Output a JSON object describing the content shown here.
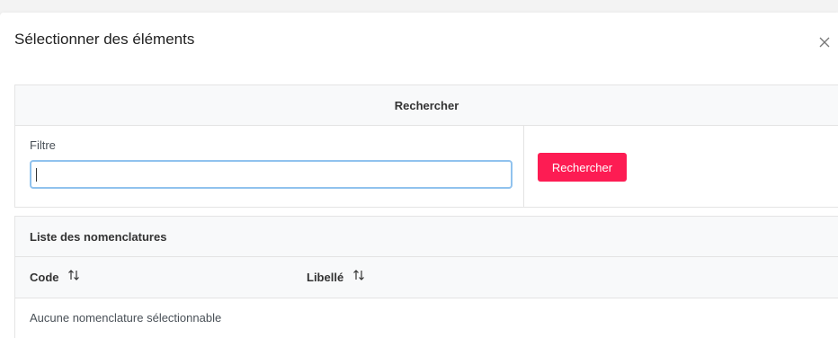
{
  "dialog": {
    "title": "Sélectionner des éléments",
    "close_icon": "close-icon"
  },
  "search": {
    "header": "Rechercher",
    "filter_label": "Filtre",
    "filter_value": "",
    "filter_placeholder": "",
    "button_label": "Rechercher",
    "button_color": "#fd1c53"
  },
  "list": {
    "header": "Liste des nomenclatures",
    "columns": [
      {
        "label": "Code",
        "sort_icon": "sort-icon"
      },
      {
        "label": "Libellé",
        "sort_icon": "sort-icon"
      }
    ],
    "empty_message": "Aucune nomenclature sélectionnable"
  }
}
